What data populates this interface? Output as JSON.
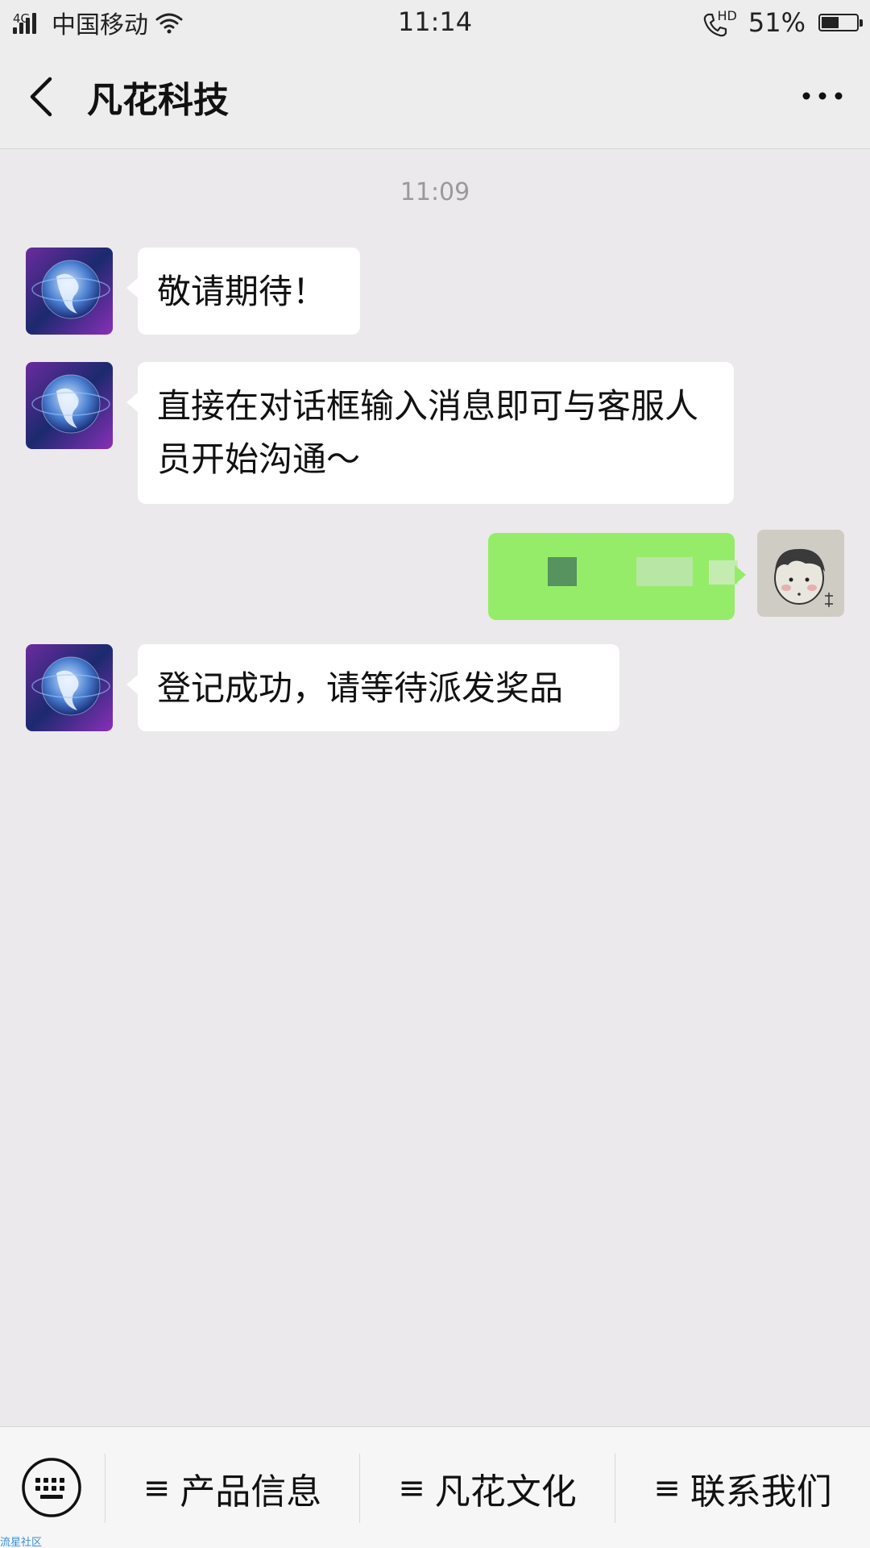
{
  "status_bar": {
    "network_type": "4G",
    "carrier": "中国移动",
    "time": "11:14",
    "hd_label": "HD",
    "battery_percent": "51%",
    "battery_level": 0.51
  },
  "header": {
    "title": "凡花科技"
  },
  "chat": {
    "timestamp": "11:09",
    "messages": [
      {
        "side": "left",
        "text": "敬请期待！"
      },
      {
        "side": "left",
        "text": "直接在对话框输入消息即可与客服人员开始沟通～"
      },
      {
        "side": "right",
        "text": ""
      },
      {
        "side": "left",
        "text": "登记成功，请等待派发奖品"
      }
    ]
  },
  "bottom_menu": {
    "items": [
      {
        "glyph": "≡",
        "label": "产品信息"
      },
      {
        "glyph": "≡",
        "label": "凡花文化"
      },
      {
        "glyph": "≡",
        "label": "联系我们"
      }
    ]
  },
  "watermark": "流星社区",
  "colors": {
    "chat_background": "#ebe9eb",
    "bubble_incoming": "#ffffff",
    "bubble_outgoing": "#95ec69"
  }
}
